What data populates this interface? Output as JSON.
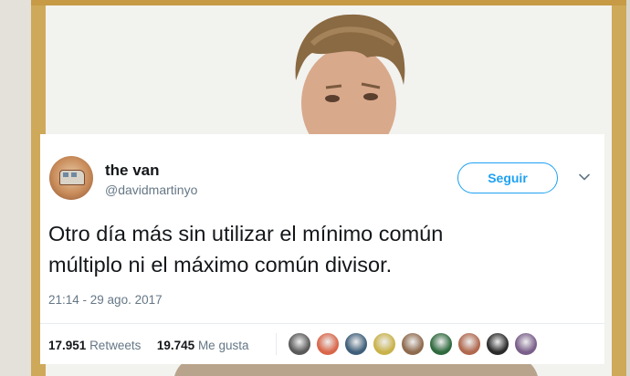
{
  "tweet": {
    "name": "the van",
    "handle": "@davidmartinyo",
    "follow_label": "Seguir",
    "text_line1": "Otro día más sin utilizar el mínimo común",
    "text_line2": "múltiplo ni el máximo común divisor.",
    "timestamp": "21:14 - 29 ago. 2017",
    "retweets_count": "17.951",
    "retweets_label": "Retweets",
    "likes_count": "19.745",
    "likes_label": "Me gusta"
  },
  "colors": {
    "accent": "#1da1f2",
    "text_primary": "#14171a",
    "text_secondary": "#657786"
  },
  "icons": {
    "avatar": "van-avatar",
    "menu": "chevron-down-icon"
  },
  "likers": [
    {
      "color": "#5a5a5a"
    },
    {
      "color": "#d9664a"
    },
    {
      "color": "#3f5f7a"
    },
    {
      "color": "#c9b24a"
    },
    {
      "color": "#8f6b4e"
    },
    {
      "color": "#2f6a3e"
    },
    {
      "color": "#b0684e"
    },
    {
      "color": "#2b2b2b"
    },
    {
      "color": "#7a5f8a"
    }
  ]
}
